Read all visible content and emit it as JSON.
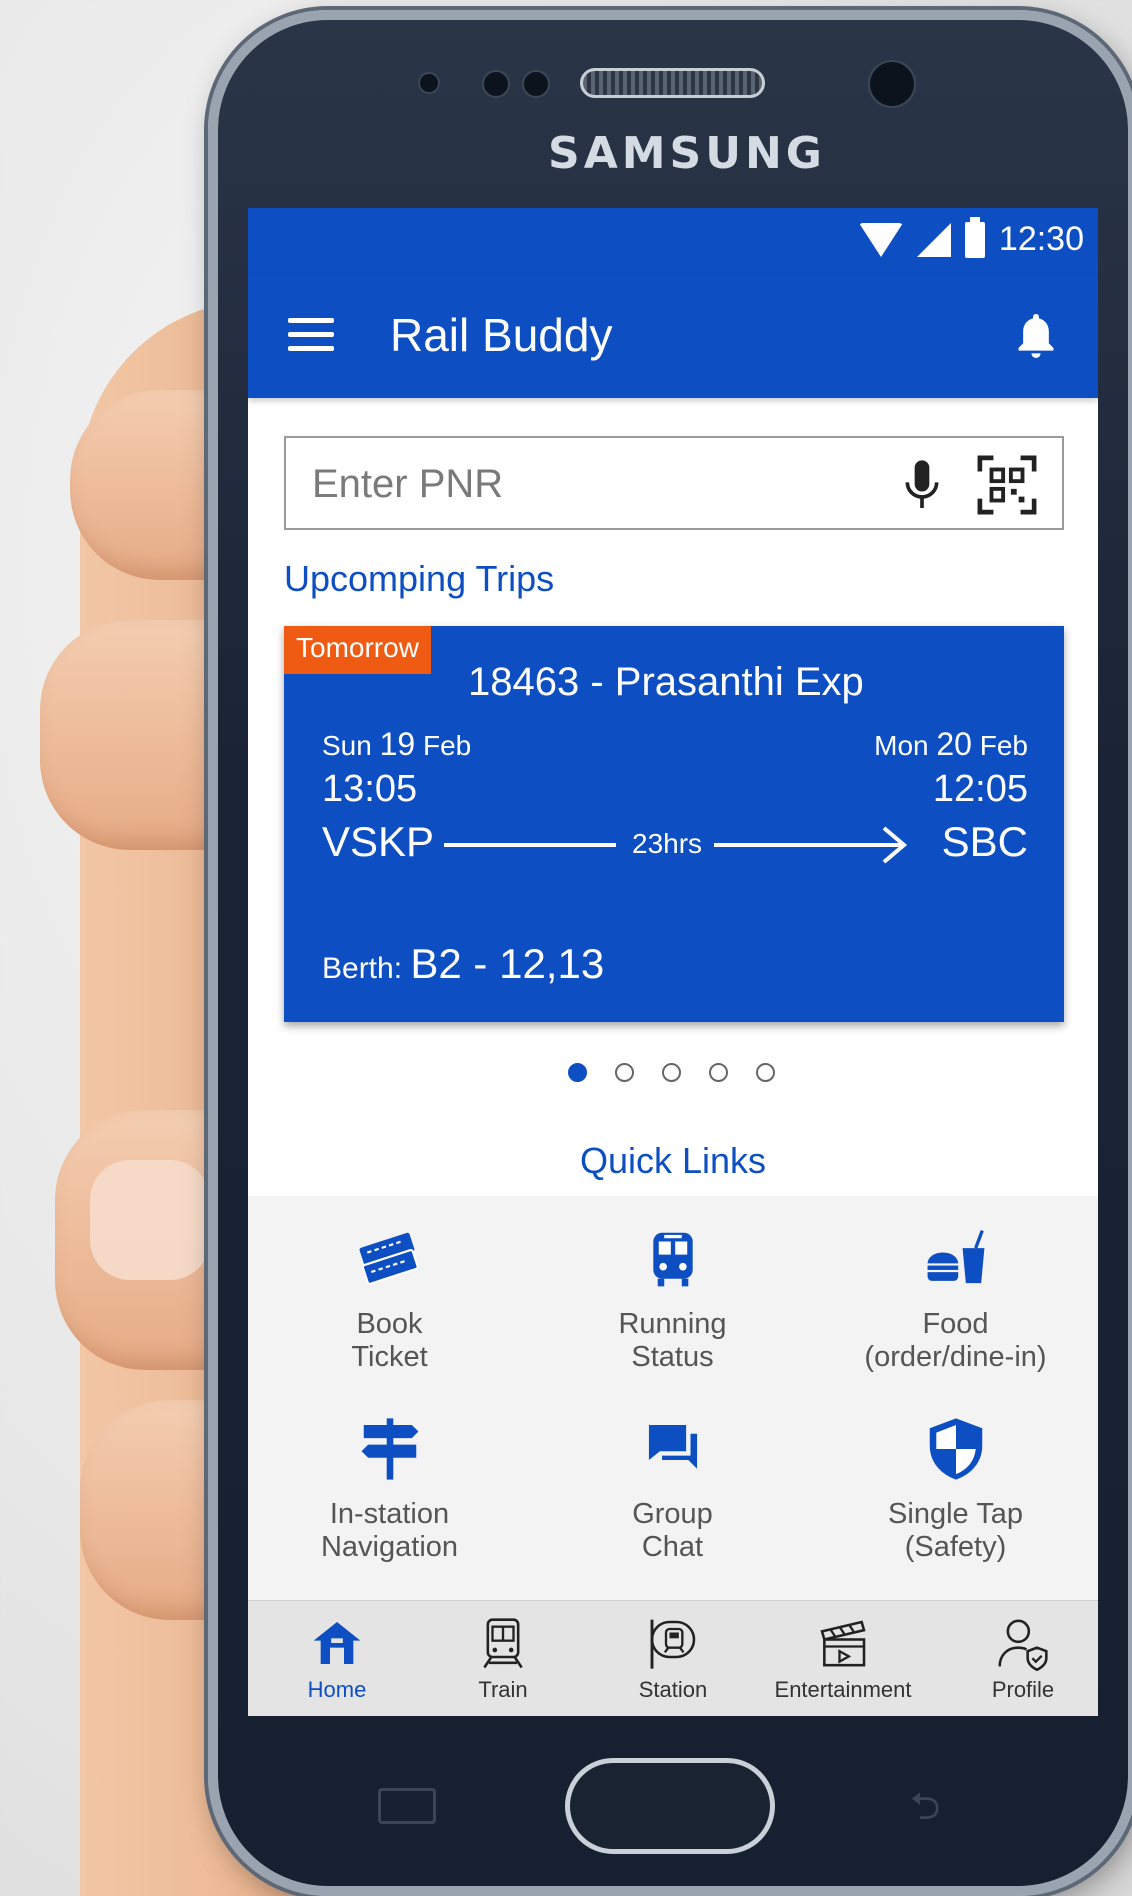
{
  "device": {
    "brand": "SAMSUNG"
  },
  "statusbar": {
    "time": "12:30"
  },
  "appbar": {
    "title": "Rail Buddy"
  },
  "search": {
    "placeholder": "Enter PNR"
  },
  "upcoming": {
    "title": "Upcomping Trips",
    "trip": {
      "badge": "Tomorrow",
      "train": "18463 - Prasanthi Exp",
      "dep_day": "Sun",
      "dep_date_num": "19",
      "dep_month": "Feb",
      "arr_day": "Mon",
      "arr_date_num": "20",
      "arr_month": "Feb",
      "dep_time": "13:05",
      "arr_time": "12:05",
      "from": "VSKP",
      "to": "SBC",
      "duration": "23hrs",
      "berth_label": "Berth:",
      "berth_value": "B2 - 12,13"
    },
    "pager": {
      "count": 5,
      "active": 0
    }
  },
  "quick_links": {
    "title": "Quick Links",
    "items": [
      {
        "line1": "Book",
        "line2": "Ticket",
        "icon": "ticket-icon"
      },
      {
        "line1": "Running",
        "line2": "Status",
        "icon": "train-front-icon"
      },
      {
        "line1": "Food",
        "line2": "(order/dine-in)",
        "icon": "food-icon"
      },
      {
        "line1": "In-station",
        "line2": "Navigation",
        "icon": "signpost-icon"
      },
      {
        "line1": "Group",
        "line2": "Chat",
        "icon": "chat-icon"
      },
      {
        "line1": "Single Tap",
        "line2": "(Safety)",
        "icon": "shield-icon"
      }
    ]
  },
  "bottom_nav": {
    "items": [
      {
        "label": "Home",
        "icon": "home-icon"
      },
      {
        "label": "Train",
        "icon": "train-icon"
      },
      {
        "label": "Station",
        "icon": "station-icon"
      },
      {
        "label": "Entertainment",
        "icon": "clapperboard-icon"
      },
      {
        "label": "Profile",
        "icon": "profile-icon"
      }
    ],
    "active_index": 0
  },
  "colors": {
    "primary": "#0d4fc2",
    "badge": "#ef5b12",
    "quick_bg": "#f3f3f3"
  }
}
